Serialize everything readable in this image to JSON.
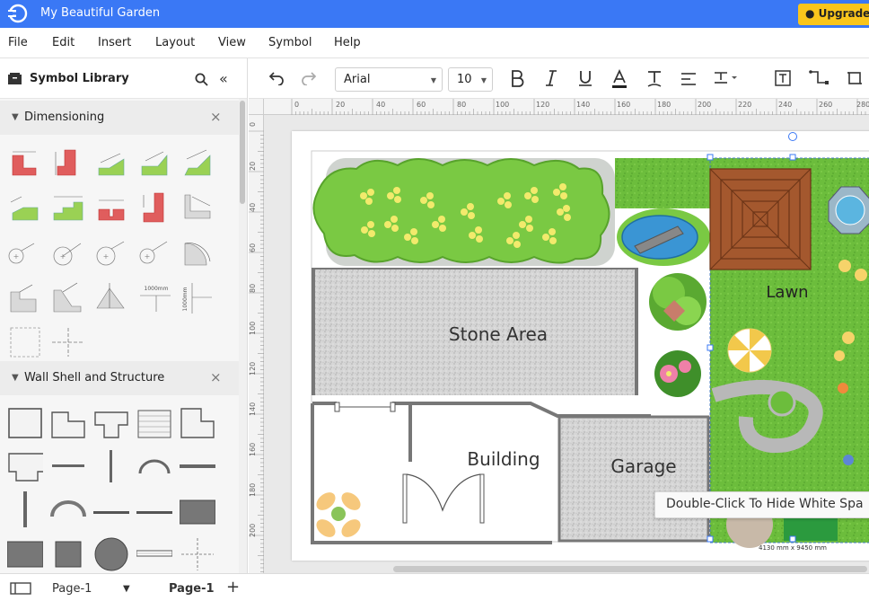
{
  "app": {
    "title": "My Beautiful Garden",
    "upgrade_label": "● Upgrade t"
  },
  "menu": [
    "File",
    "Edit",
    "Insert",
    "Layout",
    "View",
    "Symbol",
    "Help"
  ],
  "library": {
    "title": "Symbol Library",
    "sections": [
      {
        "title": "Dimensioning"
      },
      {
        "title": "Wall Shell and Structure"
      }
    ],
    "dim_labels": {
      "len": "1000mm"
    }
  },
  "toolbar": {
    "font": "Arial",
    "font_size": "10"
  },
  "ruler_h": [
    "0",
    "20",
    "40",
    "60",
    "80",
    "100",
    "120",
    "140",
    "160",
    "180",
    "200",
    "220",
    "240",
    "260",
    "280"
  ],
  "ruler_v": [
    "0",
    "20",
    "40",
    "60",
    "80",
    "100",
    "120",
    "140",
    "160",
    "180",
    "200"
  ],
  "diagram": {
    "stone_area": "Stone Area",
    "building": "Building",
    "garage": "Garage",
    "lawn": "Lawn",
    "size_label": "4130 mm x 9450 mm"
  },
  "tooltip": "Double-Click To Hide White Spa",
  "pages": {
    "tab_select": "Page-1",
    "active_tab": "Page-1"
  },
  "colors": {
    "titlebar": "#3a78f5",
    "upgrade": "#f9c51c",
    "lawn": "#6fbf3f",
    "hedge": "#7ac943",
    "stone": "#d2d2d2"
  }
}
